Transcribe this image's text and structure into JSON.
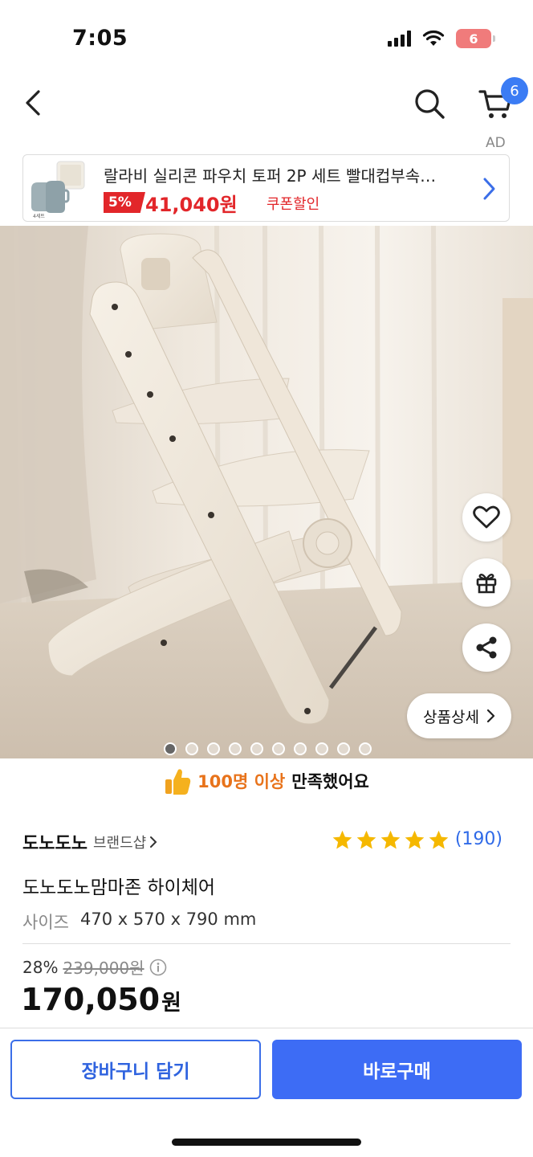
{
  "status_bar": {
    "time": "7:05",
    "battery": "6"
  },
  "nav": {
    "cart_count": "6"
  },
  "ad": {
    "label": "AD",
    "title": "랄라비 실리콘 파우치 토퍼 2P 세트 빨대컵부속…",
    "discount": "5%",
    "price": "41,040원",
    "coupon": "쿠폰할인",
    "thumb_caption": "4세트"
  },
  "gallery": {
    "detail_label": "상품상세",
    "dot_count": 10,
    "active_dot": 0
  },
  "satisfaction": {
    "highlight": "100명 이상",
    "text": "만족했어요"
  },
  "product": {
    "brand": "도노도노",
    "brand_shop": "브랜드샵",
    "rating": 5,
    "review_count": "(190)",
    "name": "도노도노맘마존 하이체어",
    "size_label": "사이즈",
    "size_value": "470 x 570 x 790 mm",
    "discount_rate": "28%",
    "original_price": "239,000원",
    "final_price": "170,050",
    "currency": "원"
  },
  "actions": {
    "add_to_cart": "장바구니 담기",
    "buy_now": "바로구매"
  },
  "colors": {
    "accent_blue": "#3d6cf5",
    "sale_red": "#e2262a",
    "star": "#f5b800"
  }
}
